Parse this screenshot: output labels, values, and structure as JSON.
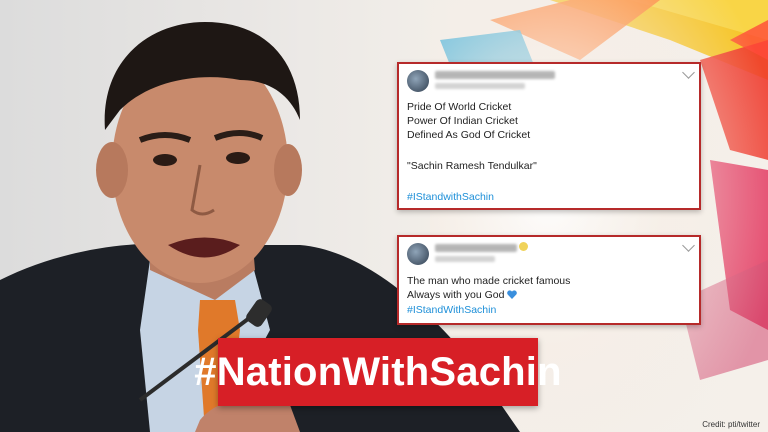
{
  "tweet1": {
    "lines": [
      "Pride Of World Cricket",
      "Power Of Indian Cricket",
      "Defined As God Of Cricket"
    ],
    "quote": "\"Sachin Ramesh Tendulkar\"",
    "hashtag": "#IStandwithSachin"
  },
  "tweet2": {
    "lines": [
      "The man who made cricket famous",
      "Always with you God"
    ],
    "heart_emoji": "blue-heart-icon",
    "hashtag": "#IStandWithSachin"
  },
  "banner": {
    "text": "#NationWithSachin"
  },
  "credit": "Credit: pti/twitter",
  "colors": {
    "banner_red": "#d71f26",
    "hashtag_blue": "#1d8fd8",
    "tweet_border": "#b62a2a"
  }
}
